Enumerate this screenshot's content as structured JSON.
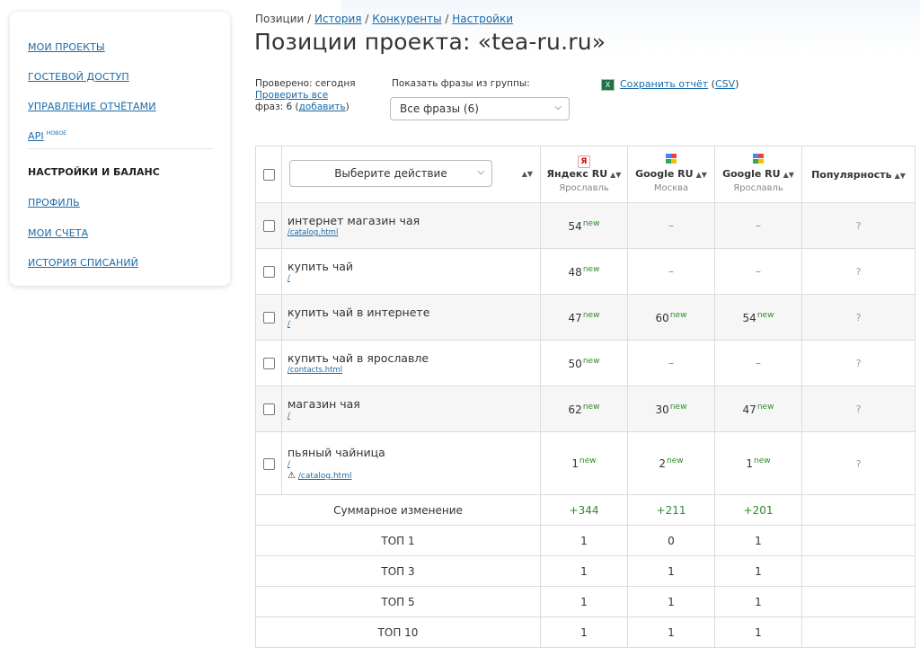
{
  "sidebar": {
    "links_top": [
      "Мои проекты",
      "Гостевой доступ",
      "Управление отчётами",
      "API"
    ],
    "api_badge": "новое",
    "heading": "Настройки и баланс",
    "links_bottom": [
      "Профиль",
      "Мои счета",
      "История списаний"
    ]
  },
  "breadcrumb": {
    "current": "Позиции",
    "sep": " / ",
    "links": [
      "История",
      "Конкуренты",
      "Настройки"
    ]
  },
  "page_title": "Позиции проекта: «tea-ru.ru»",
  "info": {
    "checked": "Проверено: сегодня",
    "check_all": "Проверить все",
    "phrases_prefix": "фраз: 6 (",
    "add": "добавить",
    "phrases_suffix": ")"
  },
  "group": {
    "label": "Показать фразы из группы:",
    "selected": "Все фразы (6)"
  },
  "report": {
    "save": "Сохранить отчёт",
    "csv": "CSV"
  },
  "table": {
    "action_placeholder": "Выберите действие",
    "engines": [
      {
        "name": "Яндекс RU",
        "city": "Ярославль",
        "icon": "yandex-icon"
      },
      {
        "name": "Google RU",
        "city": "Москва",
        "icon": "google-icon"
      },
      {
        "name": "Google RU",
        "city": "Ярославль",
        "icon": "google-icon"
      }
    ],
    "popularity": "Популярность",
    "new_mark": "new",
    "dash": "–",
    "unknown": "?",
    "rows": [
      {
        "phrase": "интернет магазин чая",
        "url": "/catalog.html",
        "pos": [
          "54",
          "–",
          "–"
        ],
        "new": [
          true,
          false,
          false
        ]
      },
      {
        "phrase": "купить чай",
        "url": "/",
        "pos": [
          "48",
          "–",
          "–"
        ],
        "new": [
          true,
          false,
          false
        ]
      },
      {
        "phrase": "купить чай в интернете",
        "url": "/",
        "pos": [
          "47",
          "60",
          "54"
        ],
        "new": [
          true,
          true,
          true
        ]
      },
      {
        "phrase": "купить чай в ярославле",
        "url": "/contacts.html",
        "pos": [
          "50",
          "–",
          "–"
        ],
        "new": [
          true,
          false,
          false
        ]
      },
      {
        "phrase": "магазин чая",
        "url": "/",
        "pos": [
          "62",
          "30",
          "47"
        ],
        "new": [
          true,
          true,
          true
        ]
      },
      {
        "phrase": "пьяный чайница",
        "url": "/",
        "warn_url": "/catalog.html",
        "pos": [
          "1",
          "2",
          "1"
        ],
        "new": [
          true,
          true,
          true
        ]
      }
    ],
    "summary": [
      {
        "label": "Суммарное изменение",
        "values": [
          "+344",
          "+211",
          "+201"
        ]
      },
      {
        "label": "ТОП 1",
        "values": [
          "1",
          "0",
          "1"
        ]
      },
      {
        "label": "ТОП 3",
        "values": [
          "1",
          "1",
          "1"
        ]
      },
      {
        "label": "ТОП 5",
        "values": [
          "1",
          "1",
          "1"
        ]
      },
      {
        "label": "ТОП 10",
        "values": [
          "1",
          "1",
          "1"
        ]
      }
    ]
  }
}
